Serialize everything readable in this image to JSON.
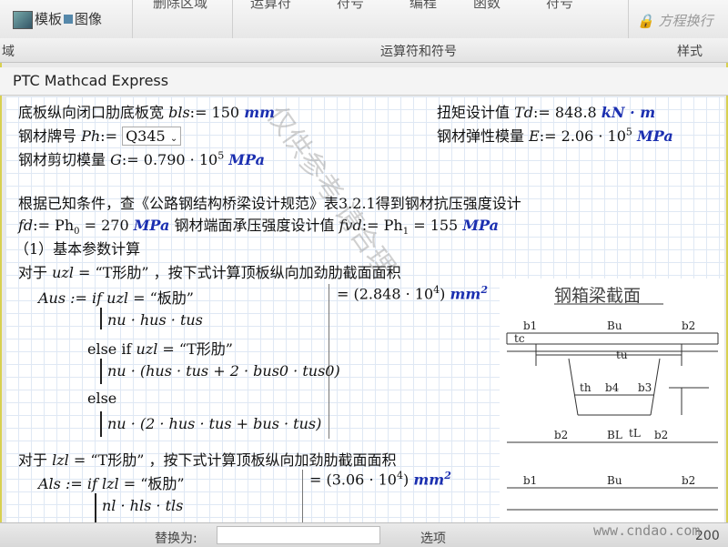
{
  "ribbon": {
    "template_label": "模板",
    "image_label": "图像",
    "delete_region_label": "删除区域",
    "operators_label": "运算符",
    "symbols_label": "符号",
    "characters_label": "编程",
    "functions_label": "函数",
    "symbol2_label": "符号",
    "replace_label": "方程换行",
    "group_left_label": "域",
    "group_mid_label": "运算符和符号",
    "group_right_label": "样式"
  },
  "app": {
    "title": "PTC Mathcad Express"
  },
  "sheet": {
    "l1_text": "底板纵向闭口肋底板宽 ",
    "l1_var": "bls",
    "l1_val": ":= 150 ",
    "l1_unit": "mm",
    "r1_text": "扭矩设计值  ",
    "r1_var": "Td",
    "r1_val": ":= 848.8 ",
    "r1_unit": "kN · m",
    "l2_text": "钢材牌号  ",
    "l2_var": "Ph",
    "l2_val": ":= ",
    "l2_select": "Q345",
    "r2_text": "钢材弹性模量 ",
    "r2_var": "E",
    "r2_val": ":= 2.06 · 10",
    "r2_exp": "5",
    "r2_unit": "MPa",
    "l3_text": "钢材剪切模量 ",
    "l3_var": "G",
    "l3_val": ":= 0.790 · 10",
    "l3_exp": "5",
    "l3_unit": "MPa",
    "p1": "根据已知条件，查《公路钢结构桥梁设计规范》表3.2.1得到钢材抗压强度设计",
    "fd_var": "fd",
    "fd_val": ":= Ph",
    "fd_sub": "0",
    "fd_num": " = 270 ",
    "fd_unit": "MPa",
    "fd_text": " 钢材端面承压强度设计值 ",
    "fvd_var": "fvd",
    "fvd_val": ":= Ph",
    "fvd_sub": "1",
    "fvd_num": " = 155 ",
    "fvd_unit": "MPa",
    "h1": "（1）基本参数计算",
    "c1_pre": "对于 ",
    "c1_var": "uzl",
    "c1_eq": " = “T形肋” ，按下式计算顶板纵向加劲肋截面面积",
    "aus_def": "Aus := if ",
    "aus_cond": "uzl",
    "aus_cond_val": " = “板肋”",
    "aus_res": "= (2.848 · 10",
    "aus_res_exp": "4",
    "aus_res_close": ")",
    "aus_unit": "mm",
    "aus_unit_exp": "2",
    "aus_b1": "nu · hus · tus",
    "aus_elseif": "else if ",
    "aus_elseif_val": " = “T形肋”",
    "aus_b2": "nu · (hus · tus + 2 · bus0 · tus0)",
    "aus_else": "else",
    "aus_b3": "nu · (2 · hus · tus + bus · tus)",
    "c2_pre": "对于 ",
    "c2_var": "lzl",
    "c2_eq": " = “T形肋” ，按下式计算顶板纵向加劲肋截面面积",
    "als_def": "Als := if ",
    "als_cond": "lzl",
    "als_cond_val": " = “板肋”",
    "als_res": "= (3.06 · 10",
    "als_res_exp": "4",
    "als_res_close": ")",
    "als_unit": "mm",
    "als_unit_exp": "2",
    "als_b1": "nl · hls · tls"
  },
  "figure": {
    "title": "钢箱梁截面",
    "labels": [
      "b1",
      "Bu",
      "b2",
      "tc",
      "tu",
      "th",
      "b4",
      "b3",
      "b2",
      "BL",
      "tL",
      "b2",
      "b1",
      "Bu",
      "b2"
    ]
  },
  "watermark": {
    "text": "仅供参考 请合理"
  },
  "bottom": {
    "replace_label": "替换为:",
    "options_label": "选项",
    "zoom": "200"
  },
  "site": "www.cndao.com"
}
